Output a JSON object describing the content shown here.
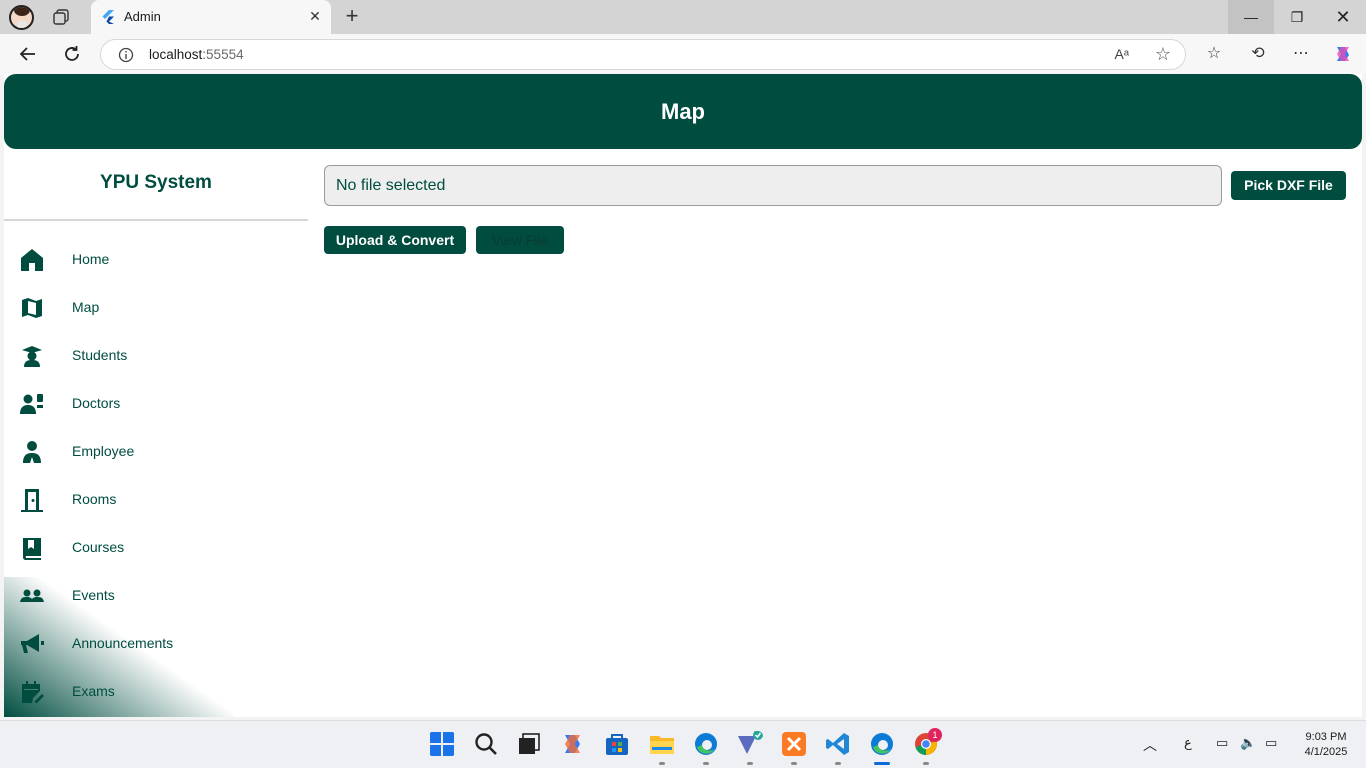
{
  "browser": {
    "tab_title": "Admin",
    "url_host": "localhost",
    "url_port": ":55554",
    "read_aloud_glyph": "Aᵃ"
  },
  "app": {
    "header_title": "Map",
    "brand": "YPU System",
    "accent_color": "#004d40",
    "nav": [
      {
        "label": "Home",
        "icon": "home-icon"
      },
      {
        "label": "Map",
        "icon": "map-icon"
      },
      {
        "label": "Students",
        "icon": "student-icon"
      },
      {
        "label": "Doctors",
        "icon": "doctors-icon"
      },
      {
        "label": "Employee",
        "icon": "employee-icon"
      },
      {
        "label": "Rooms",
        "icon": "door-icon"
      },
      {
        "label": "Courses",
        "icon": "book-icon"
      },
      {
        "label": "Events",
        "icon": "people-icon"
      },
      {
        "label": "Announcements",
        "icon": "megaphone-icon"
      },
      {
        "label": "Exams",
        "icon": "calendar-edit-icon"
      }
    ],
    "file_field_text": "No file selected",
    "pick_button": "Pick DXF File",
    "upload_button": "Upload & Convert",
    "view_button": "View File"
  },
  "taskbar": {
    "lang": "ع",
    "time": "9:03 PM",
    "date": "4/1/2025",
    "badge": "1"
  }
}
